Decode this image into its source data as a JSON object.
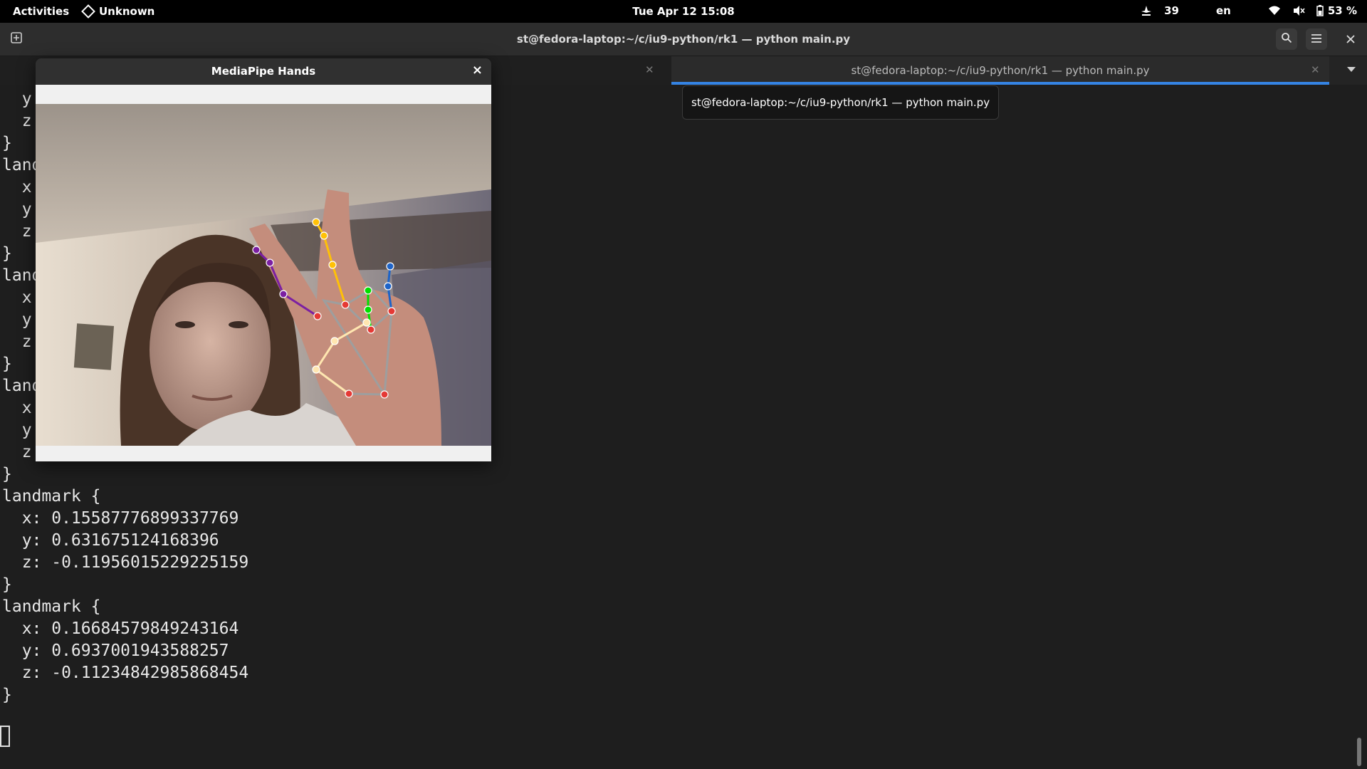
{
  "topbar": {
    "activities": "Activities",
    "app_name": "Unknown",
    "clock": "Tue Apr 12  15:08",
    "tray_count": "39",
    "language": "en",
    "battery": "53 %"
  },
  "headerbar": {
    "title": "st@fedora-laptop:~/c/iu9-python/rk1 — python main.py"
  },
  "tabs": [
    {
      "label": "",
      "active": false
    },
    {
      "label": "st@fedora-laptop:~/c/iu9-python/rk1 — python main.py",
      "active": true
    }
  ],
  "tooltip": "st@fedora-laptop:~/c/iu9-python/rk1 — python main.py",
  "terminal_lines": [
    "  y",
    "  z",
    "}",
    "land",
    "  x",
    "  y",
    "  z",
    "}",
    "land",
    "  x",
    "  y",
    "  z",
    "}",
    "land",
    "  x",
    "  y",
    "  z",
    "}",
    "landmark {",
    "  x: 0.15587776899337769",
    "  y: 0.631675124168396",
    "  z: -0.11956015229225159",
    "}",
    "landmark {",
    "  x: 0.16684579849243164",
    "  y: 0.6937001943588257",
    "  z: -0.11234842985868454",
    "}"
  ],
  "mediapipe_window": {
    "title": "MediaPipe Hands",
    "close": "×"
  },
  "icons": {
    "app": "diamond-icon",
    "new_tab": "new-tab-icon",
    "search": "search-icon",
    "menu": "hamburger-menu-icon",
    "close": "close-icon",
    "network": "wifi-icon",
    "volume": "volume-muted-icon",
    "battery": "battery-icon",
    "tray": "accessibility-icon"
  },
  "colors": {
    "accent": "#3584e4",
    "thumb": "#ffe6b0",
    "index": "#7b1fa2",
    "middle": "#ffc107",
    "ring": "#00e000",
    "pinky": "#1e64c8",
    "joint": "#e53935",
    "palm": "#9e9e9e"
  }
}
